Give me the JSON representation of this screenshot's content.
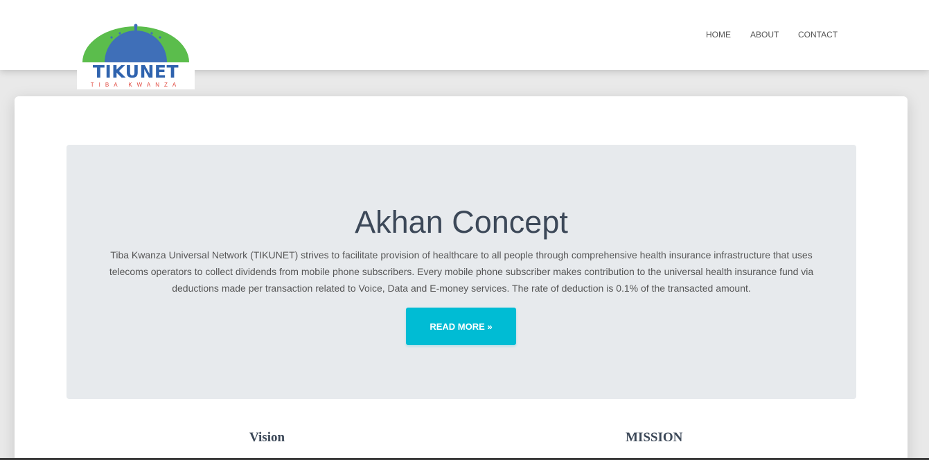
{
  "brand": {
    "name": "TIKUNET",
    "tagline": "TIBA KWANZA",
    "colors": {
      "blue": "#3f6fb8",
      "green": "#5bbd4c",
      "red": "#e0463c"
    }
  },
  "nav": {
    "items": [
      {
        "label": "HOME"
      },
      {
        "label": "ABOUT"
      },
      {
        "label": "CONTACT"
      }
    ]
  },
  "hero": {
    "title": "Akhan Concept",
    "text": "Tiba Kwanza Universal Network (TIKUNET) strives to facilitate provision of healthcare to all people through comprehensive health insurance infrastructure that uses telecoms operators to collect dividends from mobile phone subscribers. Every mobile phone subscriber makes contribution to the universal health insurance fund via deductions made per transaction related to Voice, Data and E-money services. The rate of deduction is 0.1% of the transacted amount.",
    "button_label": "READ MORE »",
    "accent_color": "#00bcd4"
  },
  "sections": {
    "vision": {
      "title": "Vision"
    },
    "mission": {
      "title": "MISSION"
    }
  }
}
